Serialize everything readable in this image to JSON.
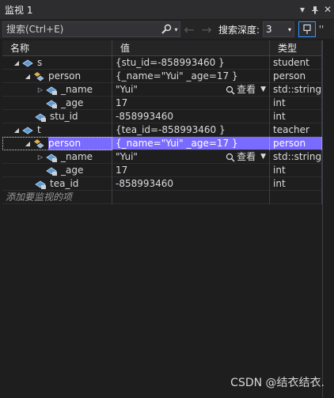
{
  "window": {
    "title": "监视 1"
  },
  "toolbar": {
    "search_placeholder": "搜索(Ctrl+E)",
    "depth_label": "搜索深度:",
    "depth_value": "3"
  },
  "columns": {
    "name": "名称",
    "value": "值",
    "type": "类型"
  },
  "rows": [
    {
      "name": "s",
      "value": "{stu_id=-858993460 }",
      "type": "student"
    },
    {
      "name": "person",
      "value": "{_name=\"Yui\" _age=17 }",
      "type": "person"
    },
    {
      "name": "_name",
      "value": "\"Yui\"",
      "type": "std::string",
      "view": "查看"
    },
    {
      "name": "_age",
      "value": "17",
      "type": "int"
    },
    {
      "name": "stu_id",
      "value": "-858993460",
      "type": "int"
    },
    {
      "name": "t",
      "value": "{tea_id=-858993460 }",
      "type": "teacher"
    },
    {
      "name": "person",
      "value": "{_name=\"Yui\" _age=17 }",
      "type": "person"
    },
    {
      "name": "_name",
      "value": "\"Yui\"",
      "type": "std::string",
      "view": "查看"
    },
    {
      "name": "_age",
      "value": "17",
      "type": "int"
    },
    {
      "name": "tea_id",
      "value": "-858993460",
      "type": "int"
    }
  ],
  "add_watch_text": "添加要监视的项",
  "watermark": "CSDN @结衣结衣.",
  "icons": {
    "dropdown": "chevron-down-icon",
    "pin": "pin-icon",
    "close": "close-icon",
    "search": "search-icon",
    "back": "arrow-left-icon",
    "forward": "arrow-right-icon"
  },
  "colors": {
    "selection": "#7a6bff",
    "background": "#1e1e1e",
    "accent": "#3399ff"
  }
}
